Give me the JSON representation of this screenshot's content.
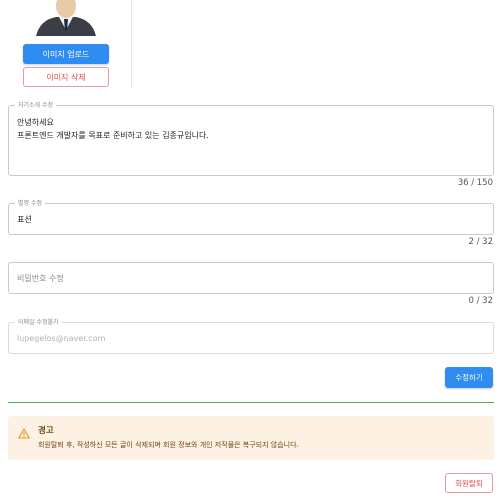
{
  "profile": {
    "upload_label": "이미지 업로드",
    "delete_label": "이미지 삭제"
  },
  "bio": {
    "legend": "자기소개 수정",
    "line1": "안녕하세요",
    "line2": "프론트엔드 개발자를 목표로 준비하고 있는 김종규입니다.",
    "counter": "36 / 150"
  },
  "nickname": {
    "legend": "별명 수정",
    "value": "표션",
    "counter": "2 / 32"
  },
  "password": {
    "placeholder": "비밀번호 수정",
    "counter": "0 / 32"
  },
  "email": {
    "legend": "이메일 수정불가",
    "value": "lupegelos@naver.com"
  },
  "submit_label": "수정하기",
  "warning": {
    "title": "경고",
    "message": "회원탈퇴 후, 작성하신 모든 글이 삭제되며 회원 정보와 개인 저작물은 복구되지 않습니다."
  },
  "withdraw_label": "회원탈퇴",
  "colors": {
    "primary": "#2f8cf0",
    "danger": "#e24a4a",
    "success": "#4caf50",
    "warning_bg": "#fdf1e3"
  }
}
